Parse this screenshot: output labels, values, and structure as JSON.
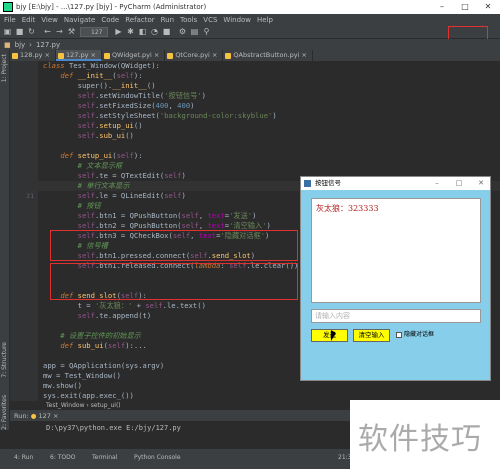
{
  "window": {
    "title": "bjy [E:\\bjy] - ...\\127.py [bjy] - PyCharm (Administrator)"
  },
  "menu": [
    "File",
    "Edit",
    "View",
    "Navigate",
    "Code",
    "Refactor",
    "Run",
    "Tools",
    "VCS",
    "Window",
    "Help"
  ],
  "toolbar": {
    "run_config": "127"
  },
  "nav": {
    "project": "bjy",
    "file": "127.py"
  },
  "tabs": [
    "128.py",
    "127.py",
    "QWidget.pyi",
    "QtCore.pyi",
    "QAbstractButton.pyi"
  ],
  "active_tab": 1,
  "sidebar": {
    "project_label": "1: Project",
    "structure_label": "7: Structure",
    "favorites_label": "2: Favorites"
  },
  "breadcrumb": {
    "class": "Test_Window",
    "method": "setup_ui()"
  },
  "run": {
    "header": "127",
    "command": "D:\\py37\\python.exe E:/bjy/127.py",
    "tab_label": "Run:"
  },
  "bottom": {
    "run": "4: Run",
    "todo": "6: TODO",
    "terminal": "Terminal",
    "console": "Python Console",
    "position": "21:3"
  },
  "qt_window": {
    "title": "按钮信号",
    "text_content": "灰太狼：323333",
    "line_placeholder": "请输入内容",
    "btn1": "发送",
    "btn2": "清空输入",
    "checkbox": "隐藏对话框"
  },
  "watermark": "软件技巧",
  "code_lines": [
    {
      "n": "",
      "t": "class Test_Window(QWidget):"
    },
    {
      "n": "",
      "t": "    def __init__(self):"
    },
    {
      "n": "",
      "t": "        super().__init__()"
    },
    {
      "n": "",
      "t": "        self.setWindowTitle('按钮信号')"
    },
    {
      "n": "",
      "t": "        self.setFixedSize(400, 400)"
    },
    {
      "n": "",
      "t": "        self.setStyleSheet('background-color:skyblue')"
    },
    {
      "n": "",
      "t": "        self.setup_ui()"
    },
    {
      "n": "",
      "t": "        self.sub_ui()"
    },
    {
      "n": "",
      "t": ""
    },
    {
      "n": "",
      "t": "    def setup_ui(self):"
    },
    {
      "n": "",
      "t": "        # 文本显示框"
    },
    {
      "n": "",
      "t": "        self.te = QTextEdit(self)"
    },
    {
      "n": "",
      "t": "        # 单行文本显示"
    },
    {
      "n": "21",
      "t": "        self.le = QLineEdit(self)"
    },
    {
      "n": "",
      "t": "        # 按钮"
    },
    {
      "n": "",
      "t": "        self.btn1 = QPushButton(self, text='发送')"
    },
    {
      "n": "",
      "t": "        self.btn2 = QPushButton(self, text='清空输入')"
    },
    {
      "n": "",
      "t": "        self.btn3 = QCheckBox(self, text='隐藏对话框')"
    },
    {
      "n": "",
      "t": "        # 信号槽"
    },
    {
      "n": "",
      "t": "        self.btn1.pressed.connect(self.send_slot)"
    },
    {
      "n": "",
      "t": "        self.btn1.released.connect(lambda: self.le.clear())"
    },
    {
      "n": "",
      "t": ""
    },
    {
      "n": "",
      "t": ""
    },
    {
      "n": "",
      "t": "    def send_slot(self):"
    },
    {
      "n": "",
      "t": "        t = '灰太狼：' + self.le.text()"
    },
    {
      "n": "",
      "t": "        self.te.append(t)"
    },
    {
      "n": "",
      "t": ""
    },
    {
      "n": "",
      "t": "    # 设置子控件的初始显示"
    },
    {
      "n": "",
      "t": "    def sub_ui(self):..."
    },
    {
      "n": "",
      "t": ""
    },
    {
      "n": "",
      "t": "app = QApplication(sys.argv)"
    },
    {
      "n": "",
      "t": "mw = Test_Window()"
    },
    {
      "n": "",
      "t": "mw.show()"
    },
    {
      "n": "",
      "t": "sys.exit(app.exec_())"
    }
  ]
}
